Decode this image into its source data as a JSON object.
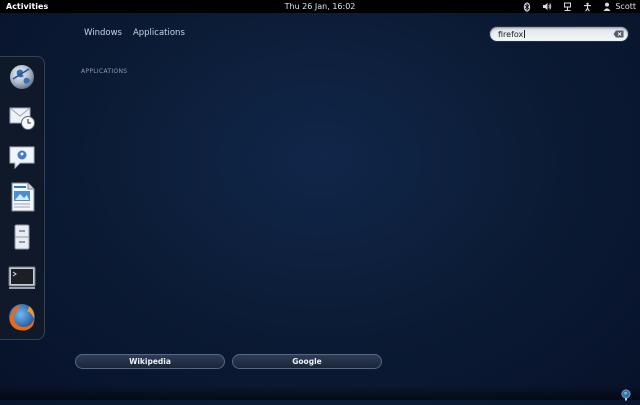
{
  "topbar": {
    "activities": "Activities",
    "clock": "Thu 26 Jan, 16:02",
    "user": "Scott",
    "tray_icons": [
      "bluetooth-icon",
      "volume-icon",
      "network-icon",
      "accessibility-icon",
      "user-icon"
    ]
  },
  "view_selector": {
    "windows": "Windows",
    "applications": "Applications"
  },
  "search": {
    "value": "firefox"
  },
  "results": {
    "section_heading": "APPLICATIONS"
  },
  "dash": {
    "items": [
      "web-browser-icon",
      "mail-clock-icon",
      "chat-icon",
      "writer-icon",
      "file-cabinet-icon",
      "terminal-icon",
      "firefox-icon"
    ]
  },
  "providers": {
    "wikipedia": "Wikipedia",
    "google": "Google"
  },
  "bottom_tray": {
    "icon": "globe-icon"
  },
  "colors": {
    "background": "#0c1b33",
    "topbar": "#000000",
    "search_field": "#e9edf1",
    "provider_button": "#223049"
  }
}
